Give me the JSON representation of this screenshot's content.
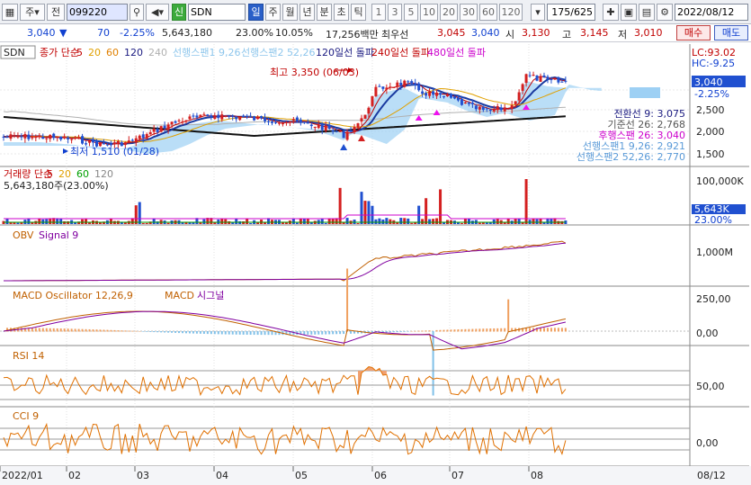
{
  "toolbar": {
    "market_icon": "grid-icon",
    "market": "주",
    "range": "전",
    "code": "099220",
    "search_icon": "search-icon",
    "sound_icon": "speaker-icon",
    "badge": "신",
    "name": "SDN",
    "periods": [
      "일",
      "주",
      "월",
      "년",
      "분",
      "초",
      "틱"
    ],
    "active_period": "일",
    "nums": [
      "1",
      "3",
      "5",
      "10",
      "20",
      "30",
      "60",
      "120"
    ],
    "count": "175/625",
    "date": "2022/08/12",
    "icons": [
      "cursor-icon",
      "save-icon",
      "table-icon",
      "settings-icon"
    ]
  },
  "quote": {
    "price": "3,040",
    "arrow": "▼",
    "change": "70",
    "rate": "-2.25%",
    "volume": "5,643,180",
    "vol_ratio": "23.00%",
    "turnover": "10.05%",
    "amount": "17,256백만",
    "market_label": "최우선",
    "ask": "3,045",
    "bid": "3,040",
    "open_label": "시",
    "open": "3,130",
    "high_label": "고",
    "high": "3,145",
    "low_label": "저",
    "low": "3,010",
    "buy": "매수",
    "sell": "매도"
  },
  "panes": {
    "price": {
      "tag": "SDN",
      "legend": [
        {
          "t": "종가 단순",
          "c": "#c00000"
        },
        {
          "t": "5",
          "c": "#c00000"
        },
        {
          "t": "20",
          "c": "#e0a000"
        },
        {
          "t": "60",
          "c": "#e08000"
        },
        {
          "t": "120",
          "c": "#1a1a80"
        },
        {
          "t": "240",
          "c": "#b0b0b0"
        },
        {
          "t": "선행스팬1 9,26",
          "c": "#8ec6ec"
        },
        {
          "t": "선행스팬2 52,26",
          "c": "#8ec6ec"
        },
        {
          "t": "120일선 돌파",
          "c": "#1a1a80"
        },
        {
          "t": "240일선 돌파",
          "c": "#c00000"
        },
        {
          "t": "480일선 돌파",
          "c": "#cc00cc"
        }
      ],
      "lc": "LC:93.02",
      "hc": "HC:-9.25",
      "ticks": [
        "2,500",
        "2,000",
        "1,500"
      ],
      "price_tag": "3,040",
      "rate_tag": "-2.25%",
      "max_label": "최고 3,350 (06/03)",
      "min_label": "최저 1,510 (01/28)",
      "ichimoku": [
        {
          "t": "전환선 9: 3,075",
          "c": "#1a1a80"
        },
        {
          "t": "기준선 26: 2,768",
          "c": "#555555"
        },
        {
          "t": "후행스팬 26: 3,040",
          "c": "#cc00cc"
        },
        {
          "t": "선행스팬1 9,26: 2,921",
          "c": "#5a9ad8"
        },
        {
          "t": "선행스팬2 52,26: 2,770",
          "c": "#5a9ad8"
        }
      ]
    },
    "volume": {
      "legend": [
        {
          "t": "거래량 단순",
          "c": "#c00000"
        },
        {
          "t": "5",
          "c": "#c00000"
        },
        {
          "t": "20",
          "c": "#e0a000"
        },
        {
          "t": "60",
          "c": "#00a000"
        },
        {
          "t": "120",
          "c": "#888888"
        }
      ],
      "value": "5,643,180주(23.00%)",
      "ticks": [
        "100,000K"
      ],
      "tag": "5,643K",
      "tag2": "23.00%"
    },
    "obv": {
      "legend": [
        {
          "t": "OBV",
          "c": "#c06000"
        },
        {
          "t": "Signal 9",
          "c": "#8000a0"
        }
      ],
      "ticks": [
        "1,000M"
      ]
    },
    "macd": {
      "legend": [
        {
          "t": "MACD Oscillator 12,26,9",
          "c": "#c06000"
        },
        {
          "t": "MACD",
          "c": "#c06000"
        },
        {
          "t": "시그널",
          "c": "#8000a0"
        }
      ],
      "ticks": [
        "250,00",
        "0,00"
      ]
    },
    "rsi": {
      "legend": [
        {
          "t": "RSI 14",
          "c": "#c06000"
        }
      ],
      "ticks": [
        "50,00"
      ]
    },
    "cci": {
      "legend": [
        {
          "t": "CCI 9",
          "c": "#c06000"
        }
      ],
      "ticks": [
        "0,00"
      ]
    }
  },
  "xaxis": [
    "2022/01",
    "02",
    "03",
    "04",
    "05",
    "06",
    "07",
    "08"
  ],
  "xaxis_end": "08/12"
}
